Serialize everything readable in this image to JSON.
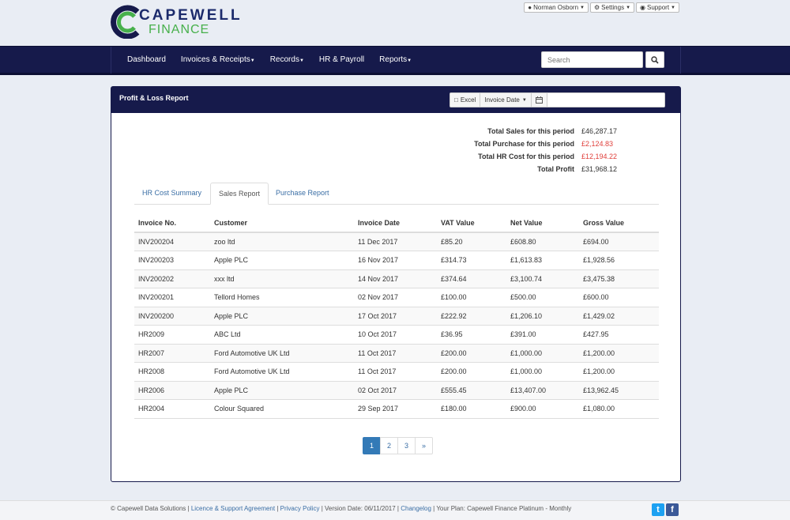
{
  "brand": {
    "line1": "CAPEWELL",
    "line2": "FINANCE",
    "colors": {
      "navy": "#161a4b",
      "green": "#47b04b"
    }
  },
  "user_menu": {
    "user": "Norman Osborn",
    "settings": "Settings",
    "support": "Support"
  },
  "nav": {
    "items": [
      "Dashboard",
      "Invoices & Receipts",
      "Records",
      "HR & Payroll",
      "Reports"
    ],
    "search_placeholder": "Search"
  },
  "panel": {
    "title": "Profit & Loss Report",
    "toolbar": {
      "excel": "Excel",
      "date_filter": "Invoice Date"
    }
  },
  "totals": [
    {
      "label": "Total Sales for this period",
      "value": "£46,287.17",
      "negative": false
    },
    {
      "label": "Total Purchase for this period",
      "value": "£2,124.83",
      "negative": true
    },
    {
      "label": "Total HR Cost for this period",
      "value": "£12,194.22",
      "negative": true
    },
    {
      "label": "Total Profit",
      "value": "£31,968.12",
      "negative": false
    }
  ],
  "tabs": [
    "HR Cost Summary",
    "Sales Report",
    "Purchase Report"
  ],
  "active_tab": "Sales Report",
  "table": {
    "headers": [
      "Invoice No.",
      "Customer",
      "Invoice Date",
      "VAT Value",
      "Net Value",
      "Gross Value"
    ],
    "rows": [
      [
        "INV200204",
        "zoo ltd",
        "11 Dec 2017",
        "£85.20",
        "£608.80",
        "£694.00"
      ],
      [
        "INV200203",
        "Apple PLC",
        "16 Nov 2017",
        "£314.73",
        "£1,613.83",
        "£1,928.56"
      ],
      [
        "INV200202",
        "xxx ltd",
        "14 Nov 2017",
        "£374.64",
        "£3,100.74",
        "£3,475.38"
      ],
      [
        "INV200201",
        "Tellord Homes",
        "02 Nov 2017",
        "£100.00",
        "£500.00",
        "£600.00"
      ],
      [
        "INV200200",
        "Apple PLC",
        "17 Oct 2017",
        "£222.92",
        "£1,206.10",
        "£1,429.02"
      ],
      [
        "HR2009",
        "ABC Ltd",
        "10 Oct 2017",
        "£36.95",
        "£391.00",
        "£427.95"
      ],
      [
        "HR2007",
        "Ford Automotive UK Ltd",
        "11 Oct 2017",
        "£200.00",
        "£1,000.00",
        "£1,200.00"
      ],
      [
        "HR2008",
        "Ford Automotive UK Ltd",
        "11 Oct 2017",
        "£200.00",
        "£1,000.00",
        "£1,200.00"
      ],
      [
        "HR2006",
        "Apple PLC",
        "02 Oct 2017",
        "£555.45",
        "£13,407.00",
        "£13,962.45"
      ],
      [
        "HR2004",
        "Colour Squared",
        "29 Sep 2017",
        "£180.00",
        "£900.00",
        "£1,080.00"
      ]
    ]
  },
  "pagination": {
    "pages": [
      "1",
      "2",
      "3"
    ],
    "next": "»",
    "current": "1"
  },
  "footer": {
    "copyright": "© Capewell Data Solutions |",
    "licence": "Licence & Support Agreement",
    "sep1": "|",
    "privacy": "Privacy Policy",
    "version": "| Version Date: 06/11/2017 |",
    "changelog": "Changelog",
    "plan": "| Your Plan: Capewell Finance Platinum - Monthly"
  }
}
